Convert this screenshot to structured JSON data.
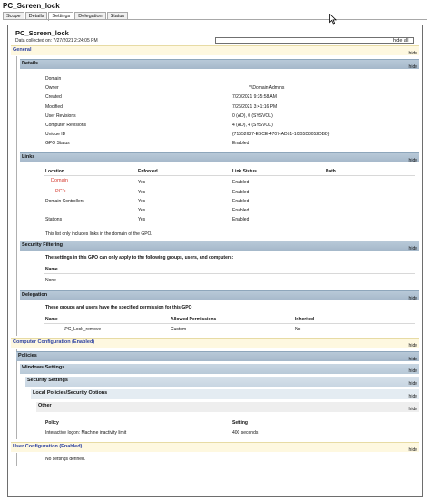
{
  "window": {
    "title": "PC_Screen_lock",
    "tabs": [
      "Scope",
      "Details",
      "Settings",
      "Delegation",
      "Status"
    ]
  },
  "report": {
    "title": "PC_Screen_lock",
    "collected": "Data collected on: 7/27/2021 2:24:05 PM",
    "hide_all": "hide all"
  },
  "hide_label": "hide",
  "general": {
    "title": "General",
    "details": {
      "title": "Details",
      "rows": [
        {
          "label": "Domain",
          "value": ""
        },
        {
          "label": "Owner",
          "value": "*\\Domain Admins"
        },
        {
          "label": "Created",
          "value": "7/20/2021 9:35:58 AM"
        },
        {
          "label": "Modified",
          "value": "7/26/2021 3:41:16 PM"
        },
        {
          "label": "User Revisions",
          "value": "0 (AD), 0 (SYSVOL)"
        },
        {
          "label": "Computer Revisions",
          "value": "4 (AD), 4 (SYSVOL)"
        },
        {
          "label": "Unique ID",
          "value": "{71552637-EBCE-4707-AD51-1CB5D8052DBD}"
        },
        {
          "label": "GPO Status",
          "value": "Enabled"
        }
      ]
    },
    "links": {
      "title": "Links",
      "headers": {
        "location": "Location",
        "enforced": "Enforced",
        "status": "Link Status",
        "path": "Path"
      },
      "rows": [
        {
          "location": "Domain",
          "enforced": "Yes",
          "status": "Enabled",
          "red": true
        },
        {
          "location": "PC's",
          "enforced": "Yes",
          "status": "Enabled",
          "red": true
        },
        {
          "location": "Domain Controllers",
          "enforced": "Yes",
          "status": "Enabled",
          "red": false
        },
        {
          "location": "",
          "enforced": "Yes",
          "status": "Enabled",
          "red": false
        },
        {
          "location": "Stations",
          "enforced": "Yes",
          "status": "Enabled",
          "red": false
        }
      ],
      "note": "This list only includes links in the domain of the GPO."
    },
    "security": {
      "title": "Security Filtering",
      "desc": "The settings in this GPO can only apply to the following groups, users, and computers:",
      "name_header": "Name",
      "value": "None"
    },
    "delegation": {
      "title": "Delegation",
      "desc": "These groups and users have the specified permission for this GPO",
      "headers": {
        "name": "Name",
        "perm": "Allowed Permissions",
        "inherited": "Inherited"
      },
      "row": {
        "name": "\\PC_Lock_remove",
        "perm": "Custom",
        "inherited": "No"
      }
    }
  },
  "computer": {
    "title": "Computer Configuration (Enabled)",
    "policies": "Policies",
    "windows_settings": "Windows Settings",
    "security_settings": "Security Settings",
    "local_policies": "Local Policies/Security Options",
    "other": "Other",
    "headers": {
      "policy": "Policy",
      "setting": "Setting"
    },
    "row": {
      "policy": "Interactive logon: Machine inactivity limit",
      "setting": "400 seconds"
    }
  },
  "user": {
    "title": "User Configuration (Enabled)",
    "value": "No settings defined."
  }
}
